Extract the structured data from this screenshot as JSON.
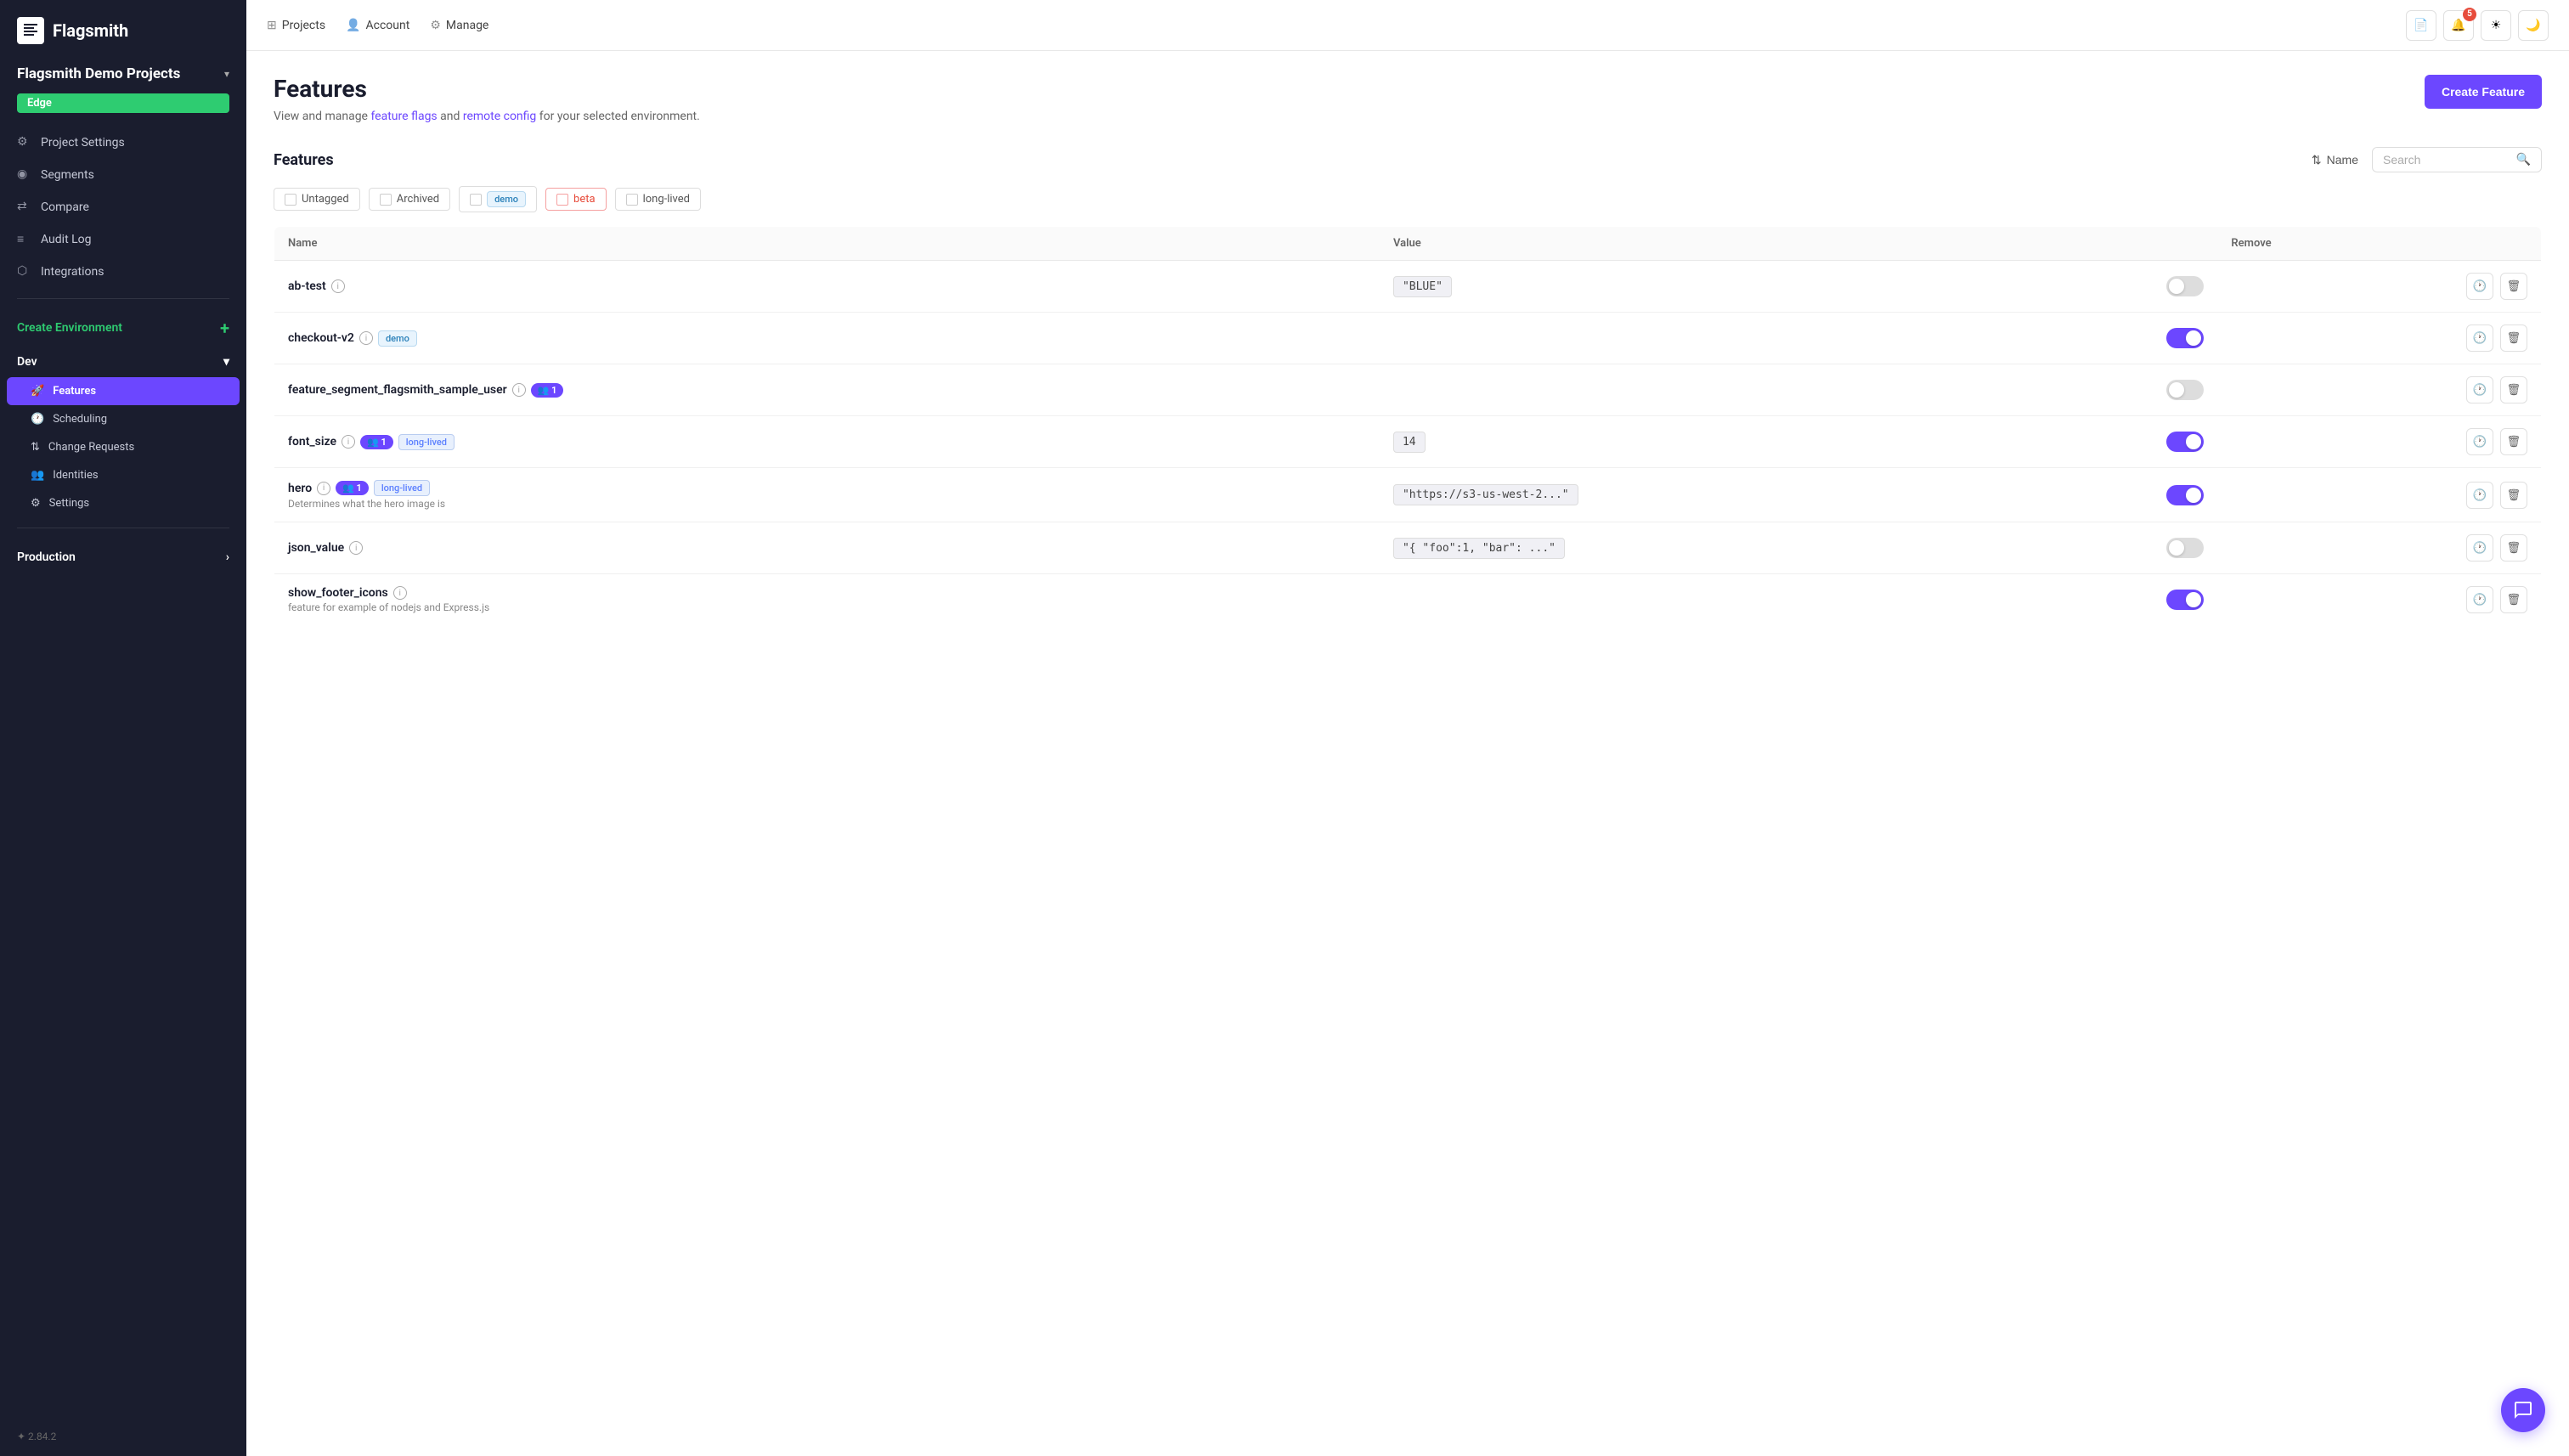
{
  "app": {
    "logo_text": "Flagsmith",
    "version": "2.84.2"
  },
  "sidebar": {
    "project_name": "Flagsmith Demo Projects",
    "current_env_badge": "Edge",
    "nav_items": [
      {
        "id": "project-settings",
        "label": "Project Settings",
        "icon": "settings"
      },
      {
        "id": "segments",
        "label": "Segments",
        "icon": "segments"
      },
      {
        "id": "compare",
        "label": "Compare",
        "icon": "compare"
      },
      {
        "id": "audit-log",
        "label": "Audit Log",
        "icon": "audit"
      },
      {
        "id": "integrations",
        "label": "Integrations",
        "icon": "integrations"
      }
    ],
    "create_env_label": "Create Environment",
    "environments": [
      {
        "id": "dev",
        "label": "Dev",
        "sub_items": [
          {
            "id": "features",
            "label": "Features",
            "active": true,
            "icon": "rocket"
          },
          {
            "id": "scheduling",
            "label": "Scheduling",
            "icon": "clock"
          },
          {
            "id": "change-requests",
            "label": "Change Requests",
            "icon": "change"
          },
          {
            "id": "identities",
            "label": "Identities",
            "icon": "users"
          },
          {
            "id": "settings",
            "label": "Settings",
            "icon": "gear"
          }
        ]
      }
    ],
    "production_label": "Production"
  },
  "topnav": {
    "projects_label": "Projects",
    "account_label": "Account",
    "manage_label": "Manage",
    "notification_count": "5"
  },
  "page": {
    "title": "Features",
    "subtitle_text": "View and manage ",
    "feature_flags_link": "feature flags",
    "and_text": " and ",
    "remote_config_link": "remote config",
    "subtitle_end": " for your selected environment.",
    "create_btn_label": "Create Feature"
  },
  "features_section": {
    "title": "Features",
    "sort_label": "Name",
    "search_placeholder": "Search"
  },
  "filters": [
    {
      "id": "untagged",
      "label": "Untagged",
      "type": "default"
    },
    {
      "id": "archived",
      "label": "Archived",
      "type": "default"
    },
    {
      "id": "demo",
      "label": "demo",
      "type": "demo"
    },
    {
      "id": "beta",
      "label": "beta",
      "type": "beta"
    },
    {
      "id": "long-lived",
      "label": "long-lived",
      "type": "default"
    }
  ],
  "table": {
    "col_name": "Name",
    "col_value": "Value",
    "col_remove": "Remove",
    "rows": [
      {
        "id": "ab-test",
        "name": "ab-test",
        "has_info": true,
        "tags": [],
        "overrides": null,
        "value": "\"BLUE\"",
        "enabled": false,
        "description": ""
      },
      {
        "id": "checkout-v2",
        "name": "checkout-v2",
        "has_info": true,
        "tags": [
          "demo"
        ],
        "overrides": null,
        "value": "",
        "enabled": true,
        "description": ""
      },
      {
        "id": "feature-segment",
        "name": "feature_segment_flagsmith_sample_user",
        "has_info": true,
        "tags": [],
        "overrides": "1",
        "value": "",
        "enabled": false,
        "description": ""
      },
      {
        "id": "font-size",
        "name": "font_size",
        "has_info": true,
        "tags": [
          "long-lived"
        ],
        "overrides": "1",
        "value": "14",
        "enabled": true,
        "description": ""
      },
      {
        "id": "hero",
        "name": "hero",
        "has_info": true,
        "tags": [
          "long-lived"
        ],
        "overrides": "1",
        "value": "\"https://s3-us-west-2...\"",
        "enabled": true,
        "description": "Determines what the hero image is"
      },
      {
        "id": "json-value",
        "name": "json_value",
        "has_info": true,
        "tags": [],
        "overrides": null,
        "value": "\"{ \"foo\":1, \"bar\": ...\"",
        "enabled": false,
        "description": ""
      },
      {
        "id": "show-footer-icons",
        "name": "show_footer_icons",
        "has_info": true,
        "tags": [],
        "overrides": null,
        "value": "",
        "enabled": true,
        "description": "feature for example of nodejs and Express.js"
      }
    ]
  }
}
